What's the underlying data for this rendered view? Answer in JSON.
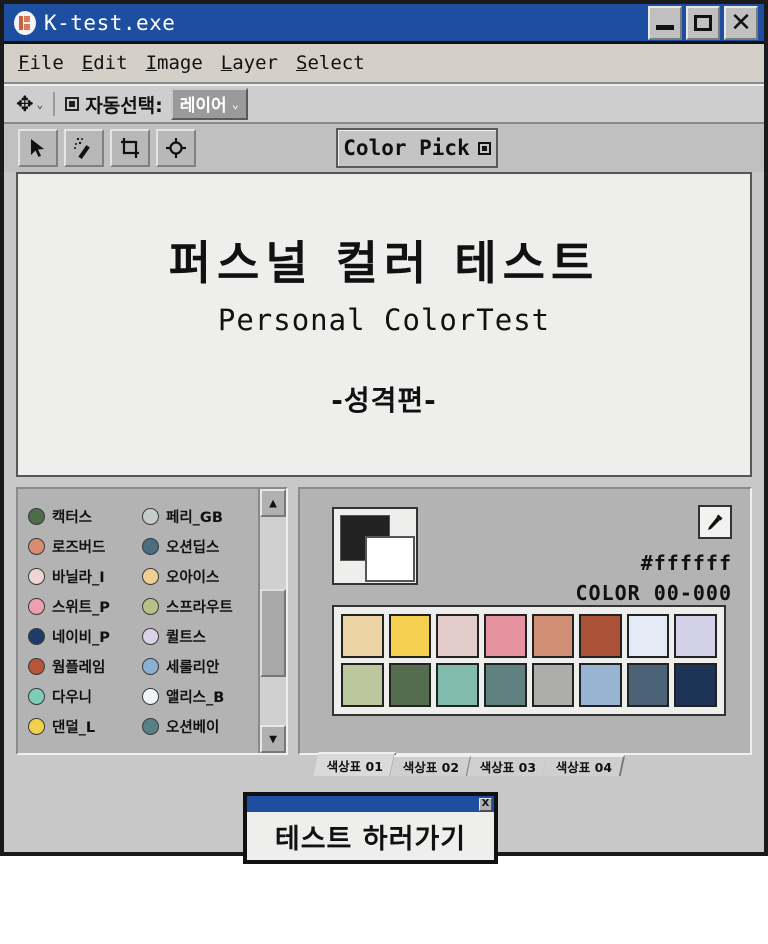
{
  "window": {
    "title": "K-test.exe",
    "app_icon": "k-logo-icon",
    "controls": {
      "minimize": "minimize-icon",
      "maximize": "maximize-icon",
      "close": "close-icon"
    }
  },
  "menu": {
    "items": [
      {
        "mnemonic": "F",
        "rest": "ile"
      },
      {
        "mnemonic": "E",
        "rest": "dit"
      },
      {
        "mnemonic": "I",
        "rest": "mage"
      },
      {
        "mnemonic": "L",
        "rest": "ayer"
      },
      {
        "mnemonic": "S",
        "rest": "elect"
      }
    ]
  },
  "options_bar": {
    "move_icon": "✥",
    "chevron": "⌄",
    "auto_select_label": "자동선택:",
    "auto_select_checked": true,
    "layer_select_value": "레이어"
  },
  "tools": {
    "buttons": [
      {
        "icon": "cursor-arrow-icon"
      },
      {
        "icon": "magic-wand-icon"
      },
      {
        "icon": "crop-icon"
      },
      {
        "icon": "target-icon"
      }
    ],
    "color_pick_label": "Color Pick",
    "color_pick_checked": true
  },
  "canvas": {
    "title_ko": "퍼스널 컬러 테스트",
    "title_en": "Personal ColorTest",
    "subtitle": "-성격편-"
  },
  "color_list": {
    "items": [
      {
        "name": "캑터스",
        "color": "#4e6b4c"
      },
      {
        "name": "페리_GB",
        "color": "#c6cdc8"
      },
      {
        "name": "로즈버드",
        "color": "#d88d72"
      },
      {
        "name": "오션딥스",
        "color": "#4a6d80"
      },
      {
        "name": "바닐라_I",
        "color": "#efd6d2"
      },
      {
        "name": "오아이스",
        "color": "#f0cf93"
      },
      {
        "name": "스위트_P",
        "color": "#eda0b0"
      },
      {
        "name": "스프라우트",
        "color": "#b5c287"
      },
      {
        "name": "네이비_P",
        "color": "#1f3c68"
      },
      {
        "name": "퀼트스",
        "color": "#d9d2e8"
      },
      {
        "name": "웜플레임",
        "color": "#b7543a"
      },
      {
        "name": "세룰리안",
        "color": "#8cafd4"
      },
      {
        "name": "다우니",
        "color": "#7ecbb6"
      },
      {
        "name": "앨리스_B",
        "color": "#f0f4fb"
      },
      {
        "name": "댄덜_L",
        "color": "#f2d04c"
      },
      {
        "name": "오션베이",
        "color": "#578086"
      }
    ],
    "scrollbar": {
      "up_arrow": "▲",
      "down_arrow": "▼"
    }
  },
  "palette_panel": {
    "foreground_color": "#222222",
    "background_color": "#ffffff",
    "eyedropper_icon": "eyedropper-icon",
    "hex_value": "#ffffff",
    "color_code": "COLOR 00-000",
    "swatches_row1": [
      "#ecd3a5",
      "#f4cf50",
      "#e2cbc9",
      "#e4939f",
      "#d08e74",
      "#ac5238",
      "#e5ebf6",
      "#d2d1e8"
    ],
    "swatches_row2": [
      "#bdc79d",
      "#566c4f",
      "#80bbab",
      "#5f817f",
      "#adaeab",
      "#97b4d3",
      "#4c6377",
      "#1e3457"
    ],
    "tabs": [
      {
        "label": "색상표 01",
        "active": true
      },
      {
        "label": "색상표 02",
        "active": false
      },
      {
        "label": "색상표 03",
        "active": false
      },
      {
        "label": "색상표 04",
        "active": false
      }
    ]
  },
  "dialog": {
    "text": "테스트 하러가기",
    "close_label": "X"
  }
}
